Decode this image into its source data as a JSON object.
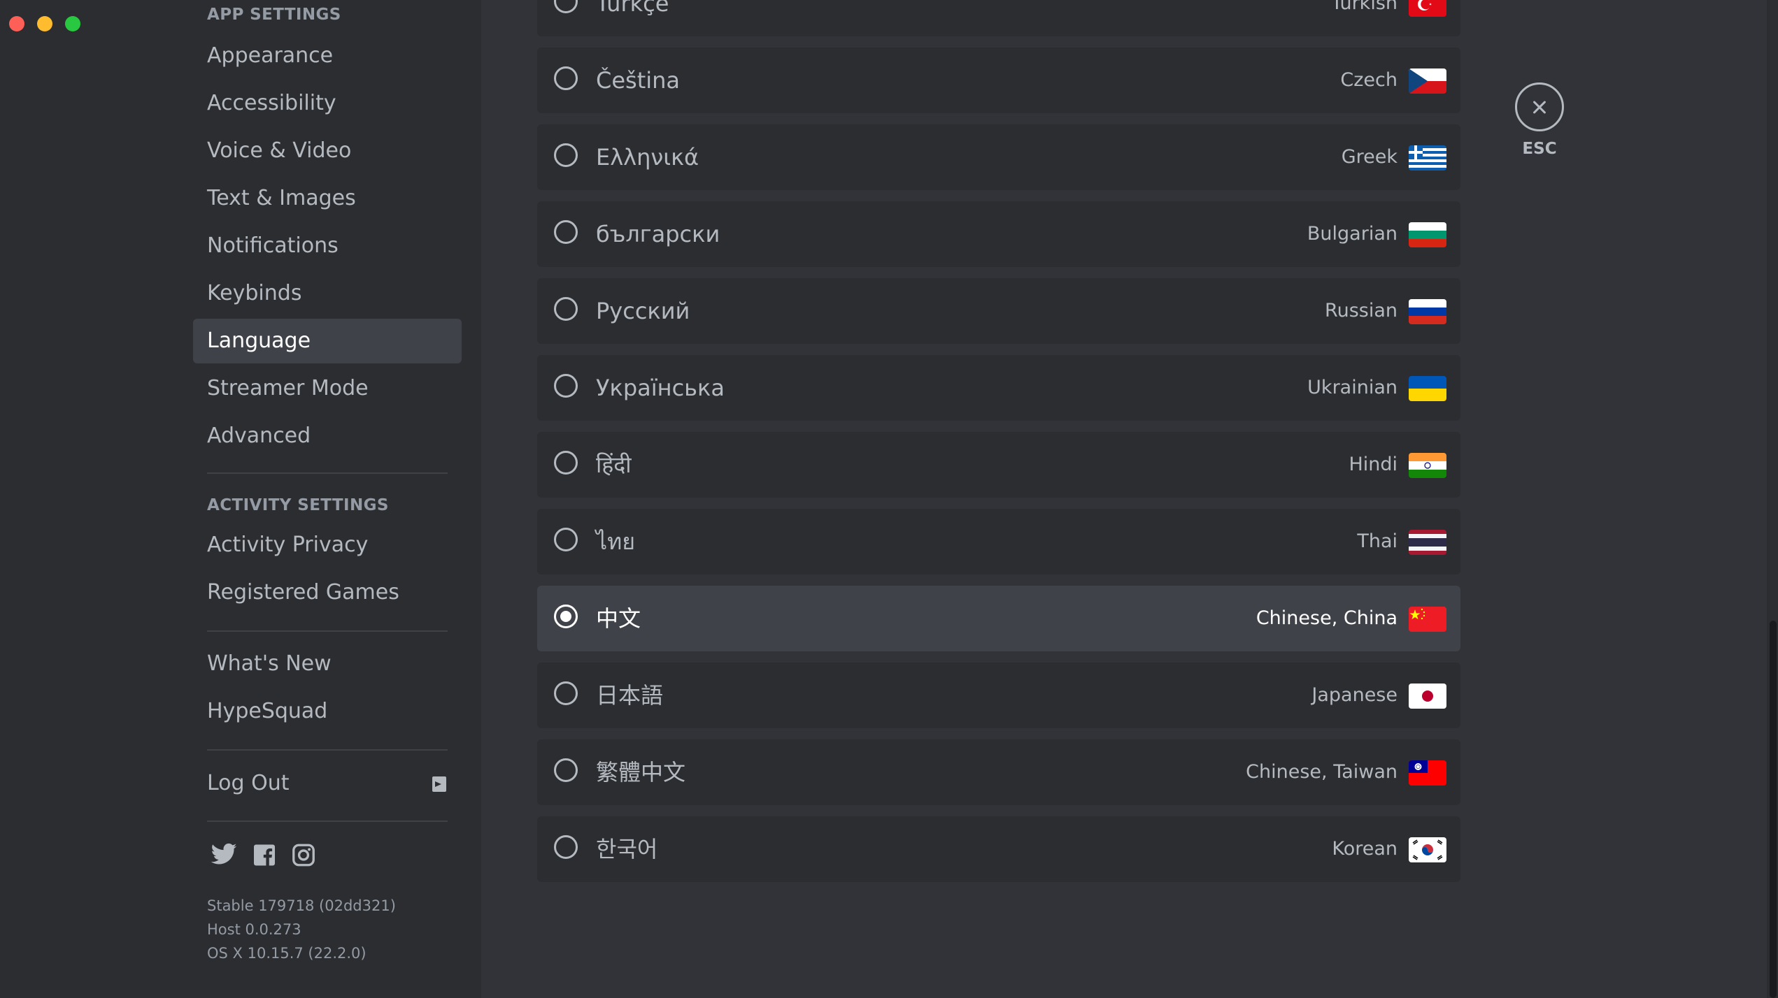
{
  "window": {
    "buttons": [
      "close",
      "minimize",
      "zoom"
    ]
  },
  "sidebar": {
    "app_settings_header": "APP SETTINGS",
    "app_settings": [
      {
        "label": "Appearance"
      },
      {
        "label": "Accessibility"
      },
      {
        "label": "Voice & Video"
      },
      {
        "label": "Text & Images"
      },
      {
        "label": "Notifications"
      },
      {
        "label": "Keybinds"
      },
      {
        "label": "Language",
        "selected": true
      },
      {
        "label": "Streamer Mode"
      },
      {
        "label": "Advanced"
      }
    ],
    "activity_settings_header": "ACTIVITY SETTINGS",
    "activity_settings": [
      {
        "label": "Activity Privacy"
      },
      {
        "label": "Registered Games"
      }
    ],
    "misc": [
      {
        "label": "What's New"
      },
      {
        "label": "HypeSquad"
      }
    ],
    "logout_label": "Log Out",
    "social_icons": [
      "twitter-icon",
      "facebook-icon",
      "instagram-icon"
    ],
    "version": {
      "line1": "Stable 179718 (02dd321)",
      "line2": "Host 0.0.273",
      "line3": "OS X 10.15.7 (22.2.0)"
    }
  },
  "languages": [
    {
      "native": "Türkçe",
      "english": "Turkish",
      "flag": "tr"
    },
    {
      "native": "Čeština",
      "english": "Czech",
      "flag": "cz"
    },
    {
      "native": "Ελληνικά",
      "english": "Greek",
      "flag": "gr"
    },
    {
      "native": "български",
      "english": "Bulgarian",
      "flag": "bg"
    },
    {
      "native": "Русский",
      "english": "Russian",
      "flag": "ru"
    },
    {
      "native": "Українська",
      "english": "Ukrainian",
      "flag": "ua"
    },
    {
      "native": "हिंदी",
      "english": "Hindi",
      "flag": "in"
    },
    {
      "native": "ไทย",
      "english": "Thai",
      "flag": "th"
    },
    {
      "native": "中文",
      "english": "Chinese, China",
      "flag": "cn",
      "selected": true
    },
    {
      "native": "日本語",
      "english": "Japanese",
      "flag": "jp"
    },
    {
      "native": "繁體中文",
      "english": "Chinese, Taiwan",
      "flag": "tw"
    },
    {
      "native": "한국어",
      "english": "Korean",
      "flag": "kr"
    }
  ],
  "close": {
    "label": "ESC"
  },
  "colors": {
    "background": "#313338",
    "sidebar": "#2b2d31",
    "selected": "#404249",
    "text_muted": "#b5bac1",
    "header": "#949ba4"
  }
}
